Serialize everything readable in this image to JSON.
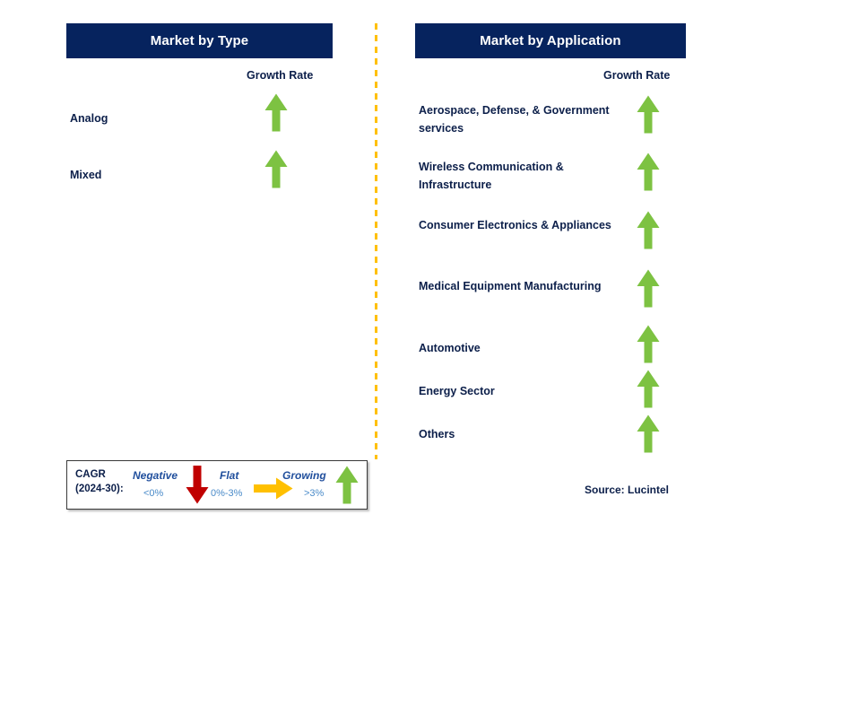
{
  "divider": {
    "color": "#FFC000",
    "style": "dashed-vertical"
  },
  "accent_colors": {
    "header_bg": "#06235E",
    "label_text": "#0C1F4A",
    "growing_arrow": "#7DC242",
    "negative_arrow": "#C00000",
    "flat_arrow": "#FFC000",
    "divider": "#FFC000"
  },
  "panels": [
    {
      "id": "market-by-type",
      "title": "Market by Type",
      "growth_rate_label": "Growth Rate",
      "rows": [
        {
          "label": "Analog",
          "trend": "growing",
          "arrow_icon": "arrow-up-icon",
          "cagr_band": ">3%"
        },
        {
          "label": "Mixed",
          "trend": "growing",
          "arrow_icon": "arrow-up-icon",
          "cagr_band": ">3%"
        }
      ]
    },
    {
      "id": "market-by-application",
      "title": "Market by Application",
      "growth_rate_label": "Growth Rate",
      "rows": [
        {
          "label": "Aerospace, Defense, & Government services",
          "trend": "growing",
          "arrow_icon": "arrow-up-icon",
          "cagr_band": ">3%"
        },
        {
          "label": "Wireless Communication & Infrastructure",
          "trend": "growing",
          "arrow_icon": "arrow-up-icon",
          "cagr_band": ">3%"
        },
        {
          "label": "Consumer Electronics & Appliances",
          "trend": "growing",
          "arrow_icon": "arrow-up-icon",
          "cagr_band": ">3%"
        },
        {
          "label": "Medical Equipment Manufacturing",
          "trend": "growing",
          "arrow_icon": "arrow-up-icon",
          "cagr_band": ">3%"
        },
        {
          "label": "Automotive",
          "trend": "growing",
          "arrow_icon": "arrow-up-icon",
          "cagr_band": ">3%"
        },
        {
          "label": "Energy Sector",
          "trend": "growing",
          "arrow_icon": "arrow-up-icon",
          "cagr_band": ">3%"
        },
        {
          "label": "Others",
          "trend": "growing",
          "arrow_icon": "arrow-up-icon",
          "cagr_band": ">3%"
        }
      ]
    }
  ],
  "legend": {
    "title_line1": "CAGR",
    "title_line2": "(2024-30):",
    "entries": [
      {
        "word": "Negative",
        "value": "<0%",
        "icon": "arrow-down-icon",
        "color": "#C00000"
      },
      {
        "word": "Flat",
        "value": "0%-3%",
        "icon": "arrow-right-icon",
        "color": "#FFC000"
      },
      {
        "word": "Growing",
        "value": ">3%",
        "icon": "arrow-up-icon",
        "color": "#7DC242"
      }
    ]
  },
  "source": "Source: Lucintel"
}
